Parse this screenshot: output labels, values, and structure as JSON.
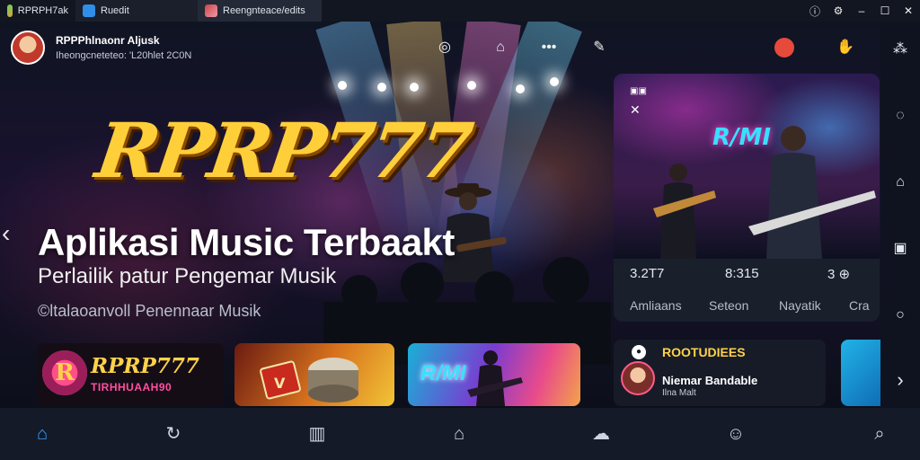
{
  "tabs": [
    {
      "label": "RPRPH7ak",
      "icon": "app-icon"
    },
    {
      "label": "Ruedit",
      "icon": "browser-icon"
    },
    {
      "label": "Reengnteace/edits",
      "icon": "image-icon"
    }
  ],
  "window_controls": [
    "info-icon",
    "settings-icon",
    "minimize-icon",
    "maximize-icon",
    "close-icon"
  ],
  "user": {
    "name": "RPPPhlnaonr Aljusk",
    "subtitle": "Iheongcneteteo: 'L20hlet 2C0N"
  },
  "hero": {
    "logo": "RPRP777",
    "title": "Aplikasi Music Terbaakt",
    "subtitle": "Perlailik patur Pengemar Musik",
    "caption": "©ltalaoanvoll Penennaar Musik"
  },
  "feature": {
    "logo_text": "R/MI",
    "stats": [
      {
        "value": "3.2T7",
        "label": "Amliaans"
      },
      {
        "value": "8:315",
        "label": "Seteon"
      },
      {
        "value": "",
        "label": "Nayatik"
      },
      {
        "value": "3 ⊕",
        "label": "Cra"
      }
    ]
  },
  "cards": [
    {
      "badge": "R",
      "title": "RPRP777",
      "subtitle": "TIRHHUAAH90"
    },
    {
      "title": ""
    },
    {
      "title": "R/MI"
    }
  ],
  "news": {
    "heading": "ROOTUDIEES",
    "title": "Niemar Bandable",
    "subtitle": "Ilna Malt"
  },
  "colors": {
    "accent": "#3aa0ff",
    "gold": "#ffd24a",
    "pink": "#ff4fa0",
    "record": "#e64a3b"
  },
  "rail_icons": [
    "share-icon",
    "chat-icon",
    "home-icon",
    "image-icon",
    "comment-icon",
    "chevron-right-icon"
  ],
  "bottom_nav": [
    "home-icon",
    "refresh-icon",
    "library-icon",
    "house-icon",
    "cloud-icon",
    "profile-icon",
    "search-icon"
  ],
  "active_nav": 0
}
